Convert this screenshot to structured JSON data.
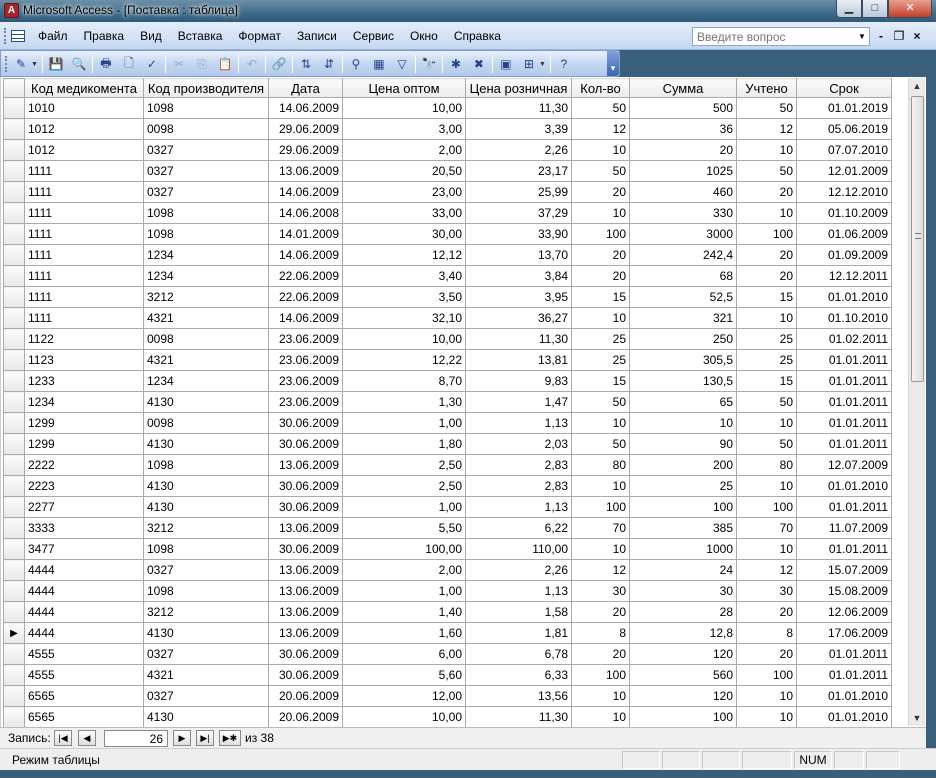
{
  "window": {
    "title": "Microsoft Access - [Поставка : таблица]",
    "buttons": {
      "minimize": "▁",
      "maximize": "□",
      "close": "✕"
    }
  },
  "menu": {
    "items": [
      {
        "label": "Файл"
      },
      {
        "label": "Правка"
      },
      {
        "label": "Вид"
      },
      {
        "label": "Вставка"
      },
      {
        "label": "Формат"
      },
      {
        "label": "Записи"
      },
      {
        "label": "Сервис"
      },
      {
        "label": "Окно"
      },
      {
        "label": "Справка"
      }
    ],
    "help_placeholder": "Введите вопрос",
    "mdi_buttons": {
      "minimize": "-",
      "restore": "❐",
      "close": "×"
    }
  },
  "toolbar": {
    "buttons": [
      {
        "name": "view",
        "glyph": "✎",
        "dropdown": true
      },
      {
        "sep": true
      },
      {
        "name": "save",
        "glyph": "💾"
      },
      {
        "name": "file-search",
        "glyph": "🔍"
      },
      {
        "sep": true
      },
      {
        "name": "print",
        "glyph": "🖶"
      },
      {
        "name": "print-preview",
        "glyph": "🗋"
      },
      {
        "name": "spelling",
        "glyph": "✓"
      },
      {
        "sep": true
      },
      {
        "name": "cut",
        "glyph": "✂",
        "disabled": true
      },
      {
        "name": "copy",
        "glyph": "⎘",
        "disabled": true
      },
      {
        "name": "paste",
        "glyph": "📋",
        "disabled": true
      },
      {
        "sep": true
      },
      {
        "name": "undo",
        "glyph": "↶",
        "disabled": true
      },
      {
        "sep": true
      },
      {
        "name": "hyperlink",
        "glyph": "🔗",
        "disabled": true
      },
      {
        "sep": true
      },
      {
        "name": "sort-ascending",
        "glyph": "⇅"
      },
      {
        "name": "sort-descending",
        "glyph": "⇵"
      },
      {
        "sep": true
      },
      {
        "name": "filter-by-selection",
        "glyph": "⚲"
      },
      {
        "name": "filter-by-form",
        "glyph": "▦"
      },
      {
        "name": "apply-filter",
        "glyph": "▽"
      },
      {
        "sep": true
      },
      {
        "name": "find",
        "glyph": "🔭"
      },
      {
        "sep": true
      },
      {
        "name": "new-record",
        "glyph": "✱"
      },
      {
        "name": "delete-record",
        "glyph": "✖"
      },
      {
        "sep": true
      },
      {
        "name": "database-window",
        "glyph": "▣"
      },
      {
        "name": "new-object",
        "glyph": "⊞",
        "dropdown": true
      },
      {
        "sep": true
      },
      {
        "name": "help",
        "glyph": "?"
      }
    ]
  },
  "table": {
    "columns": [
      "Код медикомента",
      "Код производителя",
      "Дата",
      "Цена оптом",
      "Цена розничная",
      "Кол-во",
      "Сумма",
      "Учтено",
      "Срок"
    ],
    "current_row_index": 25,
    "current_marker": "▶",
    "rows": [
      [
        "1010",
        "1098",
        "14.06.2009",
        "10,00",
        "11,30",
        "50",
        "500",
        "50",
        "01.01.2019"
      ],
      [
        "1012",
        "0098",
        "29.06.2009",
        "3,00",
        "3,39",
        "12",
        "36",
        "12",
        "05.06.2019"
      ],
      [
        "1012",
        "0327",
        "29.06.2009",
        "2,00",
        "2,26",
        "10",
        "20",
        "10",
        "07.07.2010"
      ],
      [
        "1111",
        "0327",
        "13.06.2009",
        "20,50",
        "23,17",
        "50",
        "1025",
        "50",
        "12.01.2009"
      ],
      [
        "1111",
        "0327",
        "14.06.2009",
        "23,00",
        "25,99",
        "20",
        "460",
        "20",
        "12.12.2010"
      ],
      [
        "1111",
        "1098",
        "14.06.2008",
        "33,00",
        "37,29",
        "10",
        "330",
        "10",
        "01.10.2009"
      ],
      [
        "1111",
        "1098",
        "14.01.2009",
        "30,00",
        "33,90",
        "100",
        "3000",
        "100",
        "01.06.2009"
      ],
      [
        "1111",
        "1234",
        "14.06.2009",
        "12,12",
        "13,70",
        "20",
        "242,4",
        "20",
        "01.09.2009"
      ],
      [
        "1111",
        "1234",
        "22.06.2009",
        "3,40",
        "3,84",
        "20",
        "68",
        "20",
        "12.12.2011"
      ],
      [
        "1111",
        "3212",
        "22.06.2009",
        "3,50",
        "3,95",
        "15",
        "52,5",
        "15",
        "01.01.2010"
      ],
      [
        "1111",
        "4321",
        "14.06.2009",
        "32,10",
        "36,27",
        "10",
        "321",
        "10",
        "01.10.2010"
      ],
      [
        "1122",
        "0098",
        "23.06.2009",
        "10,00",
        "11,30",
        "25",
        "250",
        "25",
        "01.02.2011"
      ],
      [
        "1123",
        "4321",
        "23.06.2009",
        "12,22",
        "13,81",
        "25",
        "305,5",
        "25",
        "01.01.2011"
      ],
      [
        "1233",
        "1234",
        "23.06.2009",
        "8,70",
        "9,83",
        "15",
        "130,5",
        "15",
        "01.01.2011"
      ],
      [
        "1234",
        "4130",
        "23.06.2009",
        "1,30",
        "1,47",
        "50",
        "65",
        "50",
        "01.01.2011"
      ],
      [
        "1299",
        "0098",
        "30.06.2009",
        "1,00",
        "1,13",
        "10",
        "10",
        "10",
        "01.01.2011"
      ],
      [
        "1299",
        "4130",
        "30.06.2009",
        "1,80",
        "2,03",
        "50",
        "90",
        "50",
        "01.01.2011"
      ],
      [
        "2222",
        "1098",
        "13.06.2009",
        "2,50",
        "2,83",
        "80",
        "200",
        "80",
        "12.07.2009"
      ],
      [
        "2223",
        "4130",
        "30.06.2009",
        "2,50",
        "2,83",
        "10",
        "25",
        "10",
        "01.01.2010"
      ],
      [
        "2277",
        "4130",
        "30.06.2009",
        "1,00",
        "1,13",
        "100",
        "100",
        "100",
        "01.01.2011"
      ],
      [
        "3333",
        "3212",
        "13.06.2009",
        "5,50",
        "6,22",
        "70",
        "385",
        "70",
        "11.07.2009"
      ],
      [
        "3477",
        "1098",
        "30.06.2009",
        "100,00",
        "110,00",
        "10",
        "1000",
        "10",
        "01.01.2011"
      ],
      [
        "4444",
        "0327",
        "13.06.2009",
        "2,00",
        "2,26",
        "12",
        "24",
        "12",
        "15.07.2009"
      ],
      [
        "4444",
        "1098",
        "13.06.2009",
        "1,00",
        "1,13",
        "30",
        "30",
        "30",
        "15.08.2009"
      ],
      [
        "4444",
        "3212",
        "13.06.2009",
        "1,40",
        "1,58",
        "20",
        "28",
        "20",
        "12.06.2009"
      ],
      [
        "4444",
        "4130",
        "13.06.2009",
        "1,60",
        "1,81",
        "8",
        "12,8",
        "8",
        "17.06.2009"
      ],
      [
        "4555",
        "0327",
        "30.06.2009",
        "6,00",
        "6,78",
        "20",
        "120",
        "20",
        "01.01.2011"
      ],
      [
        "4555",
        "4321",
        "30.06.2009",
        "5,60",
        "6,33",
        "100",
        "560",
        "100",
        "01.01.2011"
      ],
      [
        "6565",
        "0327",
        "20.06.2009",
        "12,00",
        "13,56",
        "10",
        "120",
        "10",
        "01.01.2010"
      ],
      [
        "6565",
        "4130",
        "20.06.2009",
        "10,00",
        "11,30",
        "10",
        "100",
        "10",
        "01.01.2010"
      ]
    ]
  },
  "navigator": {
    "label": "Запись:",
    "current": "26",
    "of_text": "из 38",
    "first": "|◀",
    "prev": "◀",
    "next": "▶",
    "last": "▶|",
    "new": "▶✱"
  },
  "status": {
    "text": "Режим таблицы",
    "num": "NUM"
  }
}
